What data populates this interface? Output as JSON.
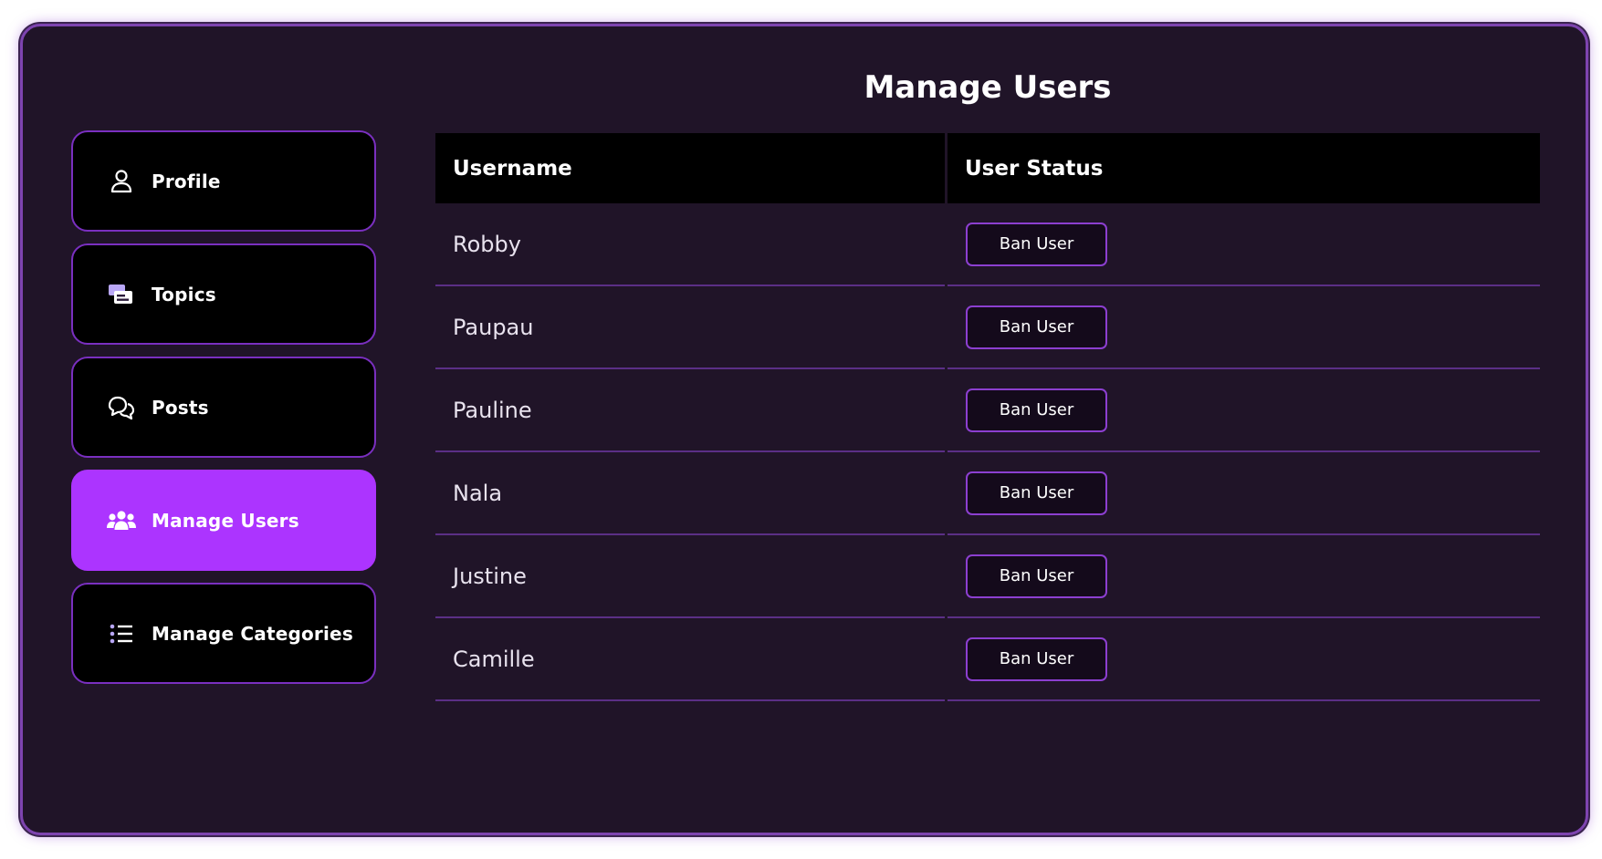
{
  "theme": {
    "background": "#201428",
    "accent": "#ac34ff",
    "border": "#7a2fc0",
    "header_bg": "#000000",
    "row_divider": "#5b2f86"
  },
  "sidebar": {
    "items": [
      {
        "label": "Profile",
        "icon": "user-icon",
        "active": false
      },
      {
        "label": "Topics",
        "icon": "topics-icon",
        "active": false
      },
      {
        "label": "Posts",
        "icon": "chat-bubbles-icon",
        "active": false
      },
      {
        "label": "Manage Users",
        "icon": "users-group-icon",
        "active": true
      },
      {
        "label": "Manage Categories",
        "icon": "list-icon",
        "active": false
      }
    ]
  },
  "main": {
    "title": "Manage Users",
    "table": {
      "columns": [
        "Username",
        "User Status"
      ],
      "rows": [
        {
          "username": "Robby",
          "action": "Ban User"
        },
        {
          "username": "Paupau",
          "action": "Ban User"
        },
        {
          "username": "Pauline",
          "action": "Ban User"
        },
        {
          "username": "Nala",
          "action": "Ban User"
        },
        {
          "username": "Justine",
          "action": "Ban User"
        },
        {
          "username": "Camille",
          "action": "Ban User"
        }
      ]
    }
  }
}
